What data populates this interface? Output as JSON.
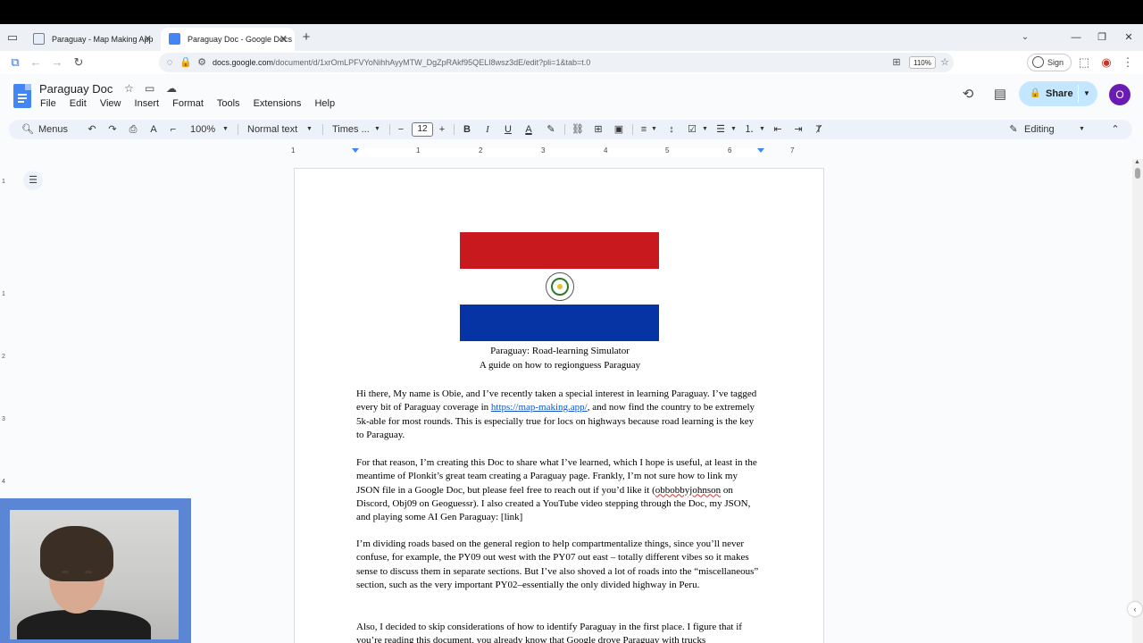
{
  "browser": {
    "tabs": [
      {
        "label": "Paraguay - Map Making App",
        "active": false
      },
      {
        "label": "Paraguay Doc - Google Docs",
        "active": true
      }
    ],
    "new_tab_label": "+",
    "url_host": "docs.google.com",
    "url_path": "/document/d/1xrOmLPFVYoNihhAyyMTW_DgZpRAkf95QELI8wsz3dE/edit?pli=1&tab=t.0",
    "zoom": "110%",
    "sign_in_label": "Sign in"
  },
  "docs": {
    "title": "Paraguay Doc",
    "menu": [
      "File",
      "Edit",
      "View",
      "Insert",
      "Format",
      "Tools",
      "Extensions",
      "Help"
    ],
    "share_label": "Share",
    "avatar_letter": "O",
    "accent_color": "#c2e7ff"
  },
  "toolbar": {
    "menus_label": "Menus",
    "zoom": "100%",
    "style": "Normal text",
    "font": "Times ...",
    "font_size": "12",
    "mode": "Editing"
  },
  "ruler": {
    "numbers": [
      "1",
      "1",
      "2",
      "3",
      "4",
      "5",
      "6",
      "7"
    ]
  },
  "vruler": {
    "numbers": [
      "1",
      "1",
      "2",
      "3",
      "4"
    ]
  },
  "document": {
    "flag_colors": {
      "red": "#c8191e",
      "white": "#ffffff",
      "blue": "#0734a4"
    },
    "caption_1": "Paraguay: Road-learning Simulator",
    "caption_2": "A guide on how to regionguess Paraguay",
    "p1": {
      "a": "Hi there, My name is Obie, and I’ve recently taken a special interest in learning Paraguay. I’ve tagged every bit of Paraguay coverage in ",
      "link": "https://map-making.app/",
      "b": ", and now find the country to be extremely 5k-able for most rounds. This is especially true for locs on highways because road learning is the key to Paraguay."
    },
    "p2": {
      "a": "For that reason, I’m creating this Doc to share what I’ve learned, which I hope is useful, at least in the meantime of Plonkit’s great team creating a Paraguay page. Frankly, I’m not sure how to link my JSON file in a Google Doc, but please feel free to reach out if you’d like it (",
      "handle": "obbobbyjohnson",
      "b": " on Discord, Obj09 on Geoguessr). I also created a YouTube video stepping through the Doc, my JSON, and playing some AI Gen Paraguay: [link]"
    },
    "p3": "I’m dividing roads based on the general region to help compartmentalize things, since you’ll never confuse, for example, the PY09 out west with the PY07 out east – totally different vibes so it makes sense to discuss them in separate sections. But I’ve also shoved a lot of roads into the “miscellaneous” section, such as the very important PY02–essentially the only divided highway in Peru.",
    "p4": "Also, I decided to skip considerations of how to identify Paraguay in the first place. I figure that if you’re reading this document, you already know that Google drove Paraguay with trucks"
  }
}
